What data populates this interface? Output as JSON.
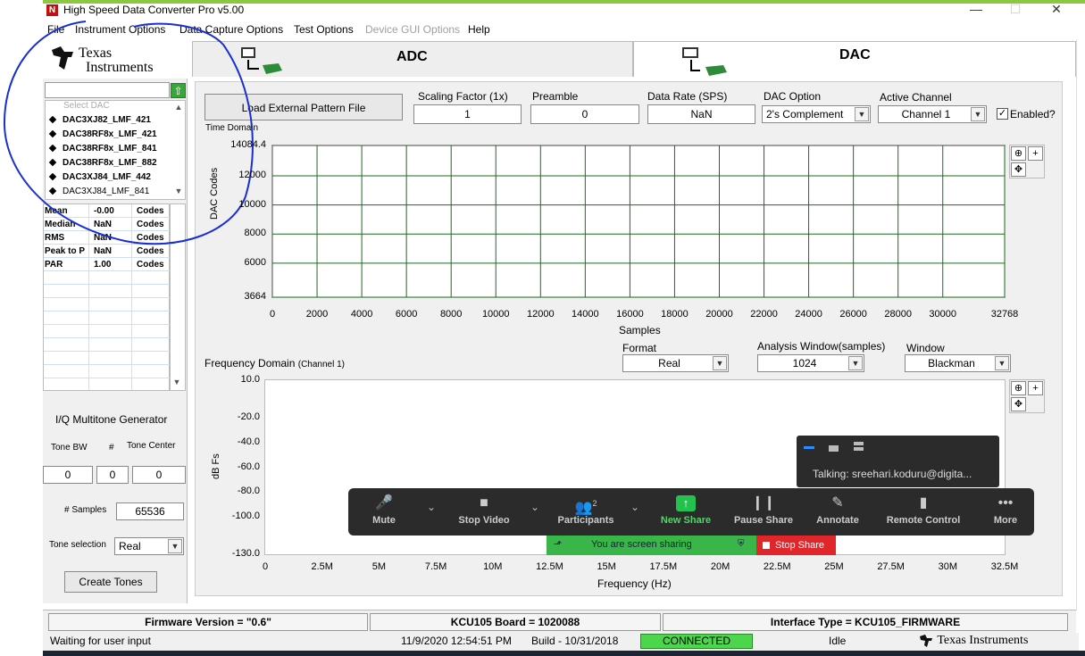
{
  "window": {
    "title": "High Speed Data Converter Pro v5.00",
    "minimize_glyph": "—",
    "maximize_glyph": "☐",
    "close_glyph": "✕"
  },
  "menu": {
    "items": [
      {
        "label": "File",
        "enabled": true
      },
      {
        "label": "Instrument Options",
        "enabled": true
      },
      {
        "label": "Data Capture Options",
        "enabled": true
      },
      {
        "label": "Test Options",
        "enabled": true
      },
      {
        "label": "Device GUI Options",
        "enabled": false
      },
      {
        "label": "Help",
        "enabled": true
      }
    ]
  },
  "brand": {
    "line1": "Texas",
    "line2": "Instruments",
    "status_logo": "Texas Instruments"
  },
  "tabs": {
    "adc": "ADC",
    "dac": "DAC",
    "active": "DAC"
  },
  "dac_select": {
    "search_value": "",
    "placeholder": "Select DAC",
    "items": [
      "DAC3XJ82_LMF_421",
      "DAC38RF8x_LMF_421",
      "DAC38RF8x_LMF_841",
      "DAC38RF8x_LMF_882",
      "DAC3XJ84_LMF_442",
      "DAC3XJ84_LMF_841"
    ]
  },
  "stats": {
    "rows": [
      {
        "name": "Mean",
        "value": "-0.00",
        "unit": "Codes"
      },
      {
        "name": "Median",
        "value": "NaN",
        "unit": "Codes"
      },
      {
        "name": "RMS",
        "value": "NaN",
        "unit": "Codes"
      },
      {
        "name": "Peak to P",
        "value": "NaN",
        "unit": "Codes"
      },
      {
        "name": "PAR",
        "value": "1.00",
        "unit": "Codes"
      }
    ]
  },
  "multitone": {
    "title": "I/Q Multitone Generator",
    "tone_bw_label": "Tone BW",
    "count_label": "#",
    "tone_center_label": "Tone Center",
    "tone_bw": "0",
    "count": "0",
    "tone_center": "0",
    "samples_label": "# Samples",
    "samples": "65536",
    "tone_selection_label": "Tone selection",
    "tone_selection": "Real",
    "create_button": "Create Tones"
  },
  "controls": {
    "load_button": "Load External Pattern File",
    "scaling_label": "Scaling Factor (1x)",
    "scaling_value": "1",
    "preamble_label": "Preamble",
    "preamble_value": "0",
    "rate_label": "Data Rate (SPS)",
    "rate_value": "NaN",
    "dac_option_label": "DAC Option",
    "dac_option_value": "2's Complement",
    "active_channel_label": "Active Channel",
    "active_channel_value": "Channel 1",
    "enabled_label": "Enabled?",
    "enabled_checked": true,
    "checkmark": "✓"
  },
  "time_domain": {
    "title": "Time Domain",
    "y_label": "DAC Codes",
    "x_label": "Samples"
  },
  "freq_domain": {
    "title": "Frequency Domain",
    "subtitle": "(Channel 1)",
    "y_label": "dB Fs",
    "x_label": "Frequency (Hz)",
    "format_label": "Format",
    "format_value": "Real",
    "analysis_label": "Analysis Window(samples)",
    "analysis_value": "1024",
    "window_label": "Window",
    "window_value": "Blackman"
  },
  "chart_data": [
    {
      "type": "line",
      "title": "Time Domain",
      "xlabel": "Samples",
      "ylabel": "DAC Codes",
      "xlim": [
        0,
        32768
      ],
      "ylim": [
        3664,
        14084.4
      ],
      "x_ticks": [
        "0",
        "2000",
        "4000",
        "6000",
        "8000",
        "10000",
        "12000",
        "14000",
        "16000",
        "18000",
        "20000",
        "22000",
        "24000",
        "26000",
        "28000",
        "30000",
        "32768"
      ],
      "y_ticks": [
        "14084.4",
        "12000",
        "10000",
        "8000",
        "6000",
        "3664"
      ],
      "grid": true,
      "series": []
    },
    {
      "type": "line",
      "title": "Frequency Domain",
      "xlabel": "Frequency (Hz)",
      "ylabel": "dB Fs",
      "xlim": [
        0,
        32.5
      ],
      "ylim": [
        -130,
        10
      ],
      "x_ticks": [
        "0",
        "2.5M",
        "5M",
        "7.5M",
        "10M",
        "12.5M",
        "15M",
        "17.5M",
        "20M",
        "22.5M",
        "25M",
        "27.5M",
        "30M",
        "32.5M"
      ],
      "y_ticks": [
        "10.0",
        "-20.0",
        "-40.0",
        "-60.0",
        "-80.0",
        "-100.0",
        "-130.0"
      ],
      "grid": false,
      "series": []
    }
  ],
  "plot_tools": {
    "zoom": "⊕",
    "pan": "✥",
    "crosshair": "+"
  },
  "zoom_meeting": {
    "toolbar": [
      {
        "label": "Mute",
        "icon": "🎤"
      },
      {
        "label": "Stop Video",
        "icon": "■"
      },
      {
        "label": "Participants",
        "icon": "👥",
        "badge": "2"
      },
      {
        "label": "New Share",
        "icon": "↑"
      },
      {
        "label": "Pause Share",
        "icon": "❙❙"
      },
      {
        "label": "Annotate",
        "icon": "✎"
      },
      {
        "label": "Remote Control",
        "icon": "▮"
      },
      {
        "label": "More",
        "icon": "•••"
      }
    ],
    "sharing_text": "You are screen sharing",
    "stop_share": "Stop Share",
    "talking": "Talking: sreehari.koduru@digita..."
  },
  "status": {
    "firmware": "Firmware Version = \"0.6\"",
    "board": "KCU105 Board = 1020088",
    "interface": "Interface Type = KCU105_FIRMWARE",
    "message": "Waiting for user input",
    "datetime": "11/9/2020 12:54:51 PM",
    "build": "Build  - 10/31/2018",
    "connection": "CONNECTED",
    "state": "Idle"
  },
  "colors": {
    "brand_red": "#c01010",
    "accent_green": "#8dc63f",
    "grid_green": "#1e6b1e",
    "connected_green": "#4cd64c",
    "annotation_blue": "#1a2fd0",
    "zoom_dark": "#2b2b2b",
    "stop_red": "#e0262b"
  }
}
